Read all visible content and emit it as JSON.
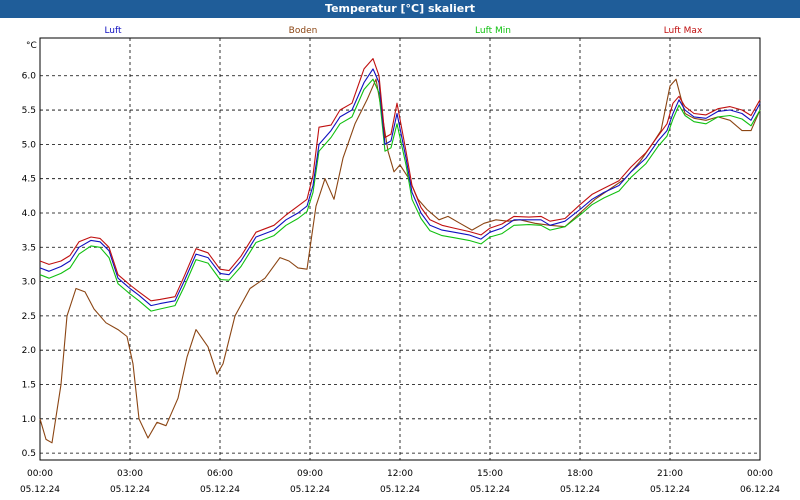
{
  "window": {
    "title": "Temperatur [°C] skaliert"
  },
  "chart_data": {
    "type": "line",
    "unit_label": "°C",
    "ylim": [
      0.4,
      6.55
    ],
    "y_ticks": [
      "6.0",
      "5.5",
      "5.0",
      "4.5",
      "4.0",
      "3.5",
      "3.0",
      "2.5",
      "2.0",
      "1.5",
      "1.0",
      "0.5"
    ],
    "y_tick_values": [
      6.0,
      5.5,
      5.0,
      4.5,
      4.0,
      3.5,
      3.0,
      2.5,
      2.0,
      1.5,
      1.0,
      0.5
    ],
    "x_ticks": [
      {
        "time": "00:00",
        "date": "05.12.24",
        "hour": 0
      },
      {
        "time": "03:00",
        "date": "05.12.24",
        "hour": 3
      },
      {
        "time": "06:00",
        "date": "05.12.24",
        "hour": 6
      },
      {
        "time": "09:00",
        "date": "05.12.24",
        "hour": 9
      },
      {
        "time": "12:00",
        "date": "05.12.24",
        "hour": 12
      },
      {
        "time": "15:00",
        "date": "05.12.24",
        "hour": 15
      },
      {
        "time": "18:00",
        "date": "05.12.24",
        "hour": 18
      },
      {
        "time": "21:00",
        "date": "05.12.24",
        "hour": 21
      },
      {
        "time": "00:00",
        "date": "06.12.24",
        "hour": 24
      }
    ],
    "xlim": [
      0,
      24
    ],
    "grid": true,
    "series": [
      {
        "name": "Luft",
        "color": "#1010c0",
        "points": [
          [
            0,
            3.2
          ],
          [
            0.3,
            3.15
          ],
          [
            0.7,
            3.22
          ],
          [
            1.0,
            3.3
          ],
          [
            1.3,
            3.5
          ],
          [
            1.7,
            3.6
          ],
          [
            2.0,
            3.58
          ],
          [
            2.3,
            3.45
          ],
          [
            2.6,
            3.05
          ],
          [
            3.0,
            2.9
          ],
          [
            3.3,
            2.8
          ],
          [
            3.7,
            2.65
          ],
          [
            4.0,
            2.68
          ],
          [
            4.5,
            2.72
          ],
          [
            4.8,
            3.0
          ],
          [
            5.2,
            3.4
          ],
          [
            5.6,
            3.35
          ],
          [
            6.0,
            3.12
          ],
          [
            6.3,
            3.1
          ],
          [
            6.7,
            3.3
          ],
          [
            7.2,
            3.65
          ],
          [
            7.8,
            3.75
          ],
          [
            8.2,
            3.9
          ],
          [
            8.6,
            4.0
          ],
          [
            8.9,
            4.1
          ],
          [
            9.1,
            4.4
          ],
          [
            9.3,
            5.0
          ],
          [
            9.7,
            5.2
          ],
          [
            10.0,
            5.4
          ],
          [
            10.4,
            5.5
          ],
          [
            10.8,
            5.9
          ],
          [
            11.1,
            6.1
          ],
          [
            11.3,
            5.9
          ],
          [
            11.5,
            5.0
          ],
          [
            11.7,
            5.05
          ],
          [
            11.9,
            5.45
          ],
          [
            12.2,
            4.8
          ],
          [
            12.4,
            4.3
          ],
          [
            12.7,
            4.0
          ],
          [
            13.0,
            3.82
          ],
          [
            13.4,
            3.75
          ],
          [
            13.8,
            3.72
          ],
          [
            14.3,
            3.68
          ],
          [
            14.7,
            3.62
          ],
          [
            15.0,
            3.72
          ],
          [
            15.4,
            3.78
          ],
          [
            15.8,
            3.9
          ],
          [
            16.3,
            3.9
          ],
          [
            16.7,
            3.9
          ],
          [
            17.0,
            3.82
          ],
          [
            17.5,
            3.88
          ],
          [
            18.0,
            4.05
          ],
          [
            18.4,
            4.2
          ],
          [
            18.8,
            4.3
          ],
          [
            19.3,
            4.4
          ],
          [
            19.7,
            4.6
          ],
          [
            20.2,
            4.8
          ],
          [
            20.6,
            5.05
          ],
          [
            20.9,
            5.2
          ],
          [
            21.1,
            5.45
          ],
          [
            21.3,
            5.65
          ],
          [
            21.5,
            5.5
          ],
          [
            21.8,
            5.4
          ],
          [
            22.2,
            5.38
          ],
          [
            22.6,
            5.48
          ],
          [
            23.0,
            5.5
          ],
          [
            23.4,
            5.45
          ],
          [
            23.7,
            5.35
          ],
          [
            24.0,
            5.6
          ]
        ]
      },
      {
        "name": "Boden",
        "color": "#8b4513",
        "points": [
          [
            0,
            1.0
          ],
          [
            0.2,
            0.7
          ],
          [
            0.4,
            0.65
          ],
          [
            0.7,
            1.5
          ],
          [
            0.9,
            2.5
          ],
          [
            1.2,
            2.9
          ],
          [
            1.5,
            2.85
          ],
          [
            1.8,
            2.6
          ],
          [
            2.2,
            2.4
          ],
          [
            2.6,
            2.3
          ],
          [
            2.9,
            2.2
          ],
          [
            3.1,
            1.8
          ],
          [
            3.3,
            1.0
          ],
          [
            3.6,
            0.72
          ],
          [
            3.9,
            0.95
          ],
          [
            4.2,
            0.9
          ],
          [
            4.6,
            1.3
          ],
          [
            4.9,
            1.9
          ],
          [
            5.2,
            2.3
          ],
          [
            5.6,
            2.05
          ],
          [
            5.9,
            1.65
          ],
          [
            6.1,
            1.8
          ],
          [
            6.5,
            2.5
          ],
          [
            7.0,
            2.9
          ],
          [
            7.5,
            3.05
          ],
          [
            8.0,
            3.35
          ],
          [
            8.3,
            3.3
          ],
          [
            8.6,
            3.2
          ],
          [
            8.9,
            3.18
          ],
          [
            9.2,
            4.1
          ],
          [
            9.5,
            4.5
          ],
          [
            9.8,
            4.2
          ],
          [
            10.1,
            4.8
          ],
          [
            10.5,
            5.3
          ],
          [
            10.9,
            5.65
          ],
          [
            11.2,
            5.95
          ],
          [
            11.4,
            5.45
          ],
          [
            11.6,
            4.9
          ],
          [
            11.8,
            4.6
          ],
          [
            12.0,
            4.7
          ],
          [
            12.3,
            4.5
          ],
          [
            12.6,
            4.2
          ],
          [
            12.9,
            4.05
          ],
          [
            13.3,
            3.9
          ],
          [
            13.6,
            3.95
          ],
          [
            14.0,
            3.85
          ],
          [
            14.4,
            3.75
          ],
          [
            14.8,
            3.85
          ],
          [
            15.2,
            3.9
          ],
          [
            15.6,
            3.88
          ],
          [
            16.0,
            3.9
          ],
          [
            16.5,
            3.85
          ],
          [
            17.0,
            3.82
          ],
          [
            17.5,
            3.8
          ],
          [
            18.0,
            4.0
          ],
          [
            18.5,
            4.2
          ],
          [
            19.0,
            4.35
          ],
          [
            19.5,
            4.5
          ],
          [
            20.0,
            4.75
          ],
          [
            20.4,
            5.0
          ],
          [
            20.7,
            5.2
          ],
          [
            21.0,
            5.85
          ],
          [
            21.2,
            5.95
          ],
          [
            21.5,
            5.45
          ],
          [
            21.8,
            5.38
          ],
          [
            22.2,
            5.35
          ],
          [
            22.6,
            5.4
          ],
          [
            23.0,
            5.35
          ],
          [
            23.4,
            5.2
          ],
          [
            23.7,
            5.2
          ],
          [
            24.0,
            5.5
          ]
        ]
      },
      {
        "name": "Luft Min",
        "color": "#10c010",
        "points": [
          [
            0,
            3.1
          ],
          [
            0.3,
            3.05
          ],
          [
            0.7,
            3.12
          ],
          [
            1.0,
            3.2
          ],
          [
            1.3,
            3.4
          ],
          [
            1.7,
            3.52
          ],
          [
            2.0,
            3.5
          ],
          [
            2.3,
            3.35
          ],
          [
            2.6,
            2.97
          ],
          [
            3.0,
            2.82
          ],
          [
            3.3,
            2.72
          ],
          [
            3.7,
            2.57
          ],
          [
            4.0,
            2.6
          ],
          [
            4.5,
            2.65
          ],
          [
            4.8,
            2.92
          ],
          [
            5.2,
            3.32
          ],
          [
            5.6,
            3.27
          ],
          [
            6.0,
            3.03
          ],
          [
            6.3,
            3.02
          ],
          [
            6.7,
            3.22
          ],
          [
            7.2,
            3.57
          ],
          [
            7.8,
            3.67
          ],
          [
            8.2,
            3.82
          ],
          [
            8.6,
            3.92
          ],
          [
            8.9,
            4.02
          ],
          [
            9.1,
            4.3
          ],
          [
            9.3,
            4.9
          ],
          [
            9.7,
            5.1
          ],
          [
            10.0,
            5.3
          ],
          [
            10.4,
            5.4
          ],
          [
            10.8,
            5.8
          ],
          [
            11.1,
            5.95
          ],
          [
            11.3,
            5.75
          ],
          [
            11.5,
            4.9
          ],
          [
            11.7,
            4.95
          ],
          [
            11.9,
            5.3
          ],
          [
            12.2,
            4.7
          ],
          [
            12.4,
            4.2
          ],
          [
            12.7,
            3.92
          ],
          [
            13.0,
            3.74
          ],
          [
            13.4,
            3.67
          ],
          [
            13.8,
            3.64
          ],
          [
            14.3,
            3.6
          ],
          [
            14.7,
            3.55
          ],
          [
            15.0,
            3.65
          ],
          [
            15.4,
            3.7
          ],
          [
            15.8,
            3.82
          ],
          [
            16.3,
            3.83
          ],
          [
            16.7,
            3.82
          ],
          [
            17.0,
            3.75
          ],
          [
            17.5,
            3.8
          ],
          [
            18.0,
            3.97
          ],
          [
            18.4,
            4.12
          ],
          [
            18.8,
            4.22
          ],
          [
            19.3,
            4.32
          ],
          [
            19.7,
            4.52
          ],
          [
            20.2,
            4.72
          ],
          [
            20.6,
            4.97
          ],
          [
            20.9,
            5.12
          ],
          [
            21.1,
            5.37
          ],
          [
            21.3,
            5.57
          ],
          [
            21.5,
            5.42
          ],
          [
            21.8,
            5.33
          ],
          [
            22.2,
            5.3
          ],
          [
            22.6,
            5.4
          ],
          [
            23.0,
            5.42
          ],
          [
            23.4,
            5.37
          ],
          [
            23.7,
            5.27
          ],
          [
            24.0,
            5.5
          ]
        ]
      },
      {
        "name": "Luft Max",
        "color": "#c01010",
        "points": [
          [
            0,
            3.3
          ],
          [
            0.3,
            3.25
          ],
          [
            0.7,
            3.3
          ],
          [
            1.0,
            3.38
          ],
          [
            1.3,
            3.58
          ],
          [
            1.7,
            3.65
          ],
          [
            2.0,
            3.63
          ],
          [
            2.3,
            3.5
          ],
          [
            2.6,
            3.1
          ],
          [
            3.0,
            2.95
          ],
          [
            3.3,
            2.85
          ],
          [
            3.7,
            2.72
          ],
          [
            4.0,
            2.74
          ],
          [
            4.5,
            2.78
          ],
          [
            4.8,
            3.07
          ],
          [
            5.2,
            3.48
          ],
          [
            5.6,
            3.42
          ],
          [
            6.0,
            3.18
          ],
          [
            6.3,
            3.16
          ],
          [
            6.7,
            3.37
          ],
          [
            7.2,
            3.72
          ],
          [
            7.8,
            3.82
          ],
          [
            8.2,
            3.97
          ],
          [
            8.6,
            4.1
          ],
          [
            8.9,
            4.2
          ],
          [
            9.1,
            4.55
          ],
          [
            9.3,
            5.25
          ],
          [
            9.7,
            5.28
          ],
          [
            10.0,
            5.5
          ],
          [
            10.4,
            5.6
          ],
          [
            10.8,
            6.1
          ],
          [
            11.1,
            6.25
          ],
          [
            11.3,
            6.0
          ],
          [
            11.5,
            5.1
          ],
          [
            11.7,
            5.15
          ],
          [
            11.9,
            5.6
          ],
          [
            12.2,
            4.9
          ],
          [
            12.4,
            4.4
          ],
          [
            12.7,
            4.08
          ],
          [
            13.0,
            3.9
          ],
          [
            13.4,
            3.82
          ],
          [
            13.8,
            3.78
          ],
          [
            14.3,
            3.73
          ],
          [
            14.7,
            3.68
          ],
          [
            15.0,
            3.78
          ],
          [
            15.4,
            3.84
          ],
          [
            15.8,
            3.95
          ],
          [
            16.3,
            3.94
          ],
          [
            16.7,
            3.95
          ],
          [
            17.0,
            3.88
          ],
          [
            17.5,
            3.92
          ],
          [
            18.0,
            4.12
          ],
          [
            18.4,
            4.27
          ],
          [
            18.8,
            4.36
          ],
          [
            19.3,
            4.47
          ],
          [
            19.7,
            4.67
          ],
          [
            20.2,
            4.88
          ],
          [
            20.6,
            5.12
          ],
          [
            20.9,
            5.3
          ],
          [
            21.1,
            5.6
          ],
          [
            21.3,
            5.7
          ],
          [
            21.5,
            5.55
          ],
          [
            21.8,
            5.45
          ],
          [
            22.2,
            5.43
          ],
          [
            22.6,
            5.52
          ],
          [
            23.0,
            5.55
          ],
          [
            23.4,
            5.5
          ],
          [
            23.7,
            5.42
          ],
          [
            24.0,
            5.65
          ]
        ]
      }
    ]
  }
}
